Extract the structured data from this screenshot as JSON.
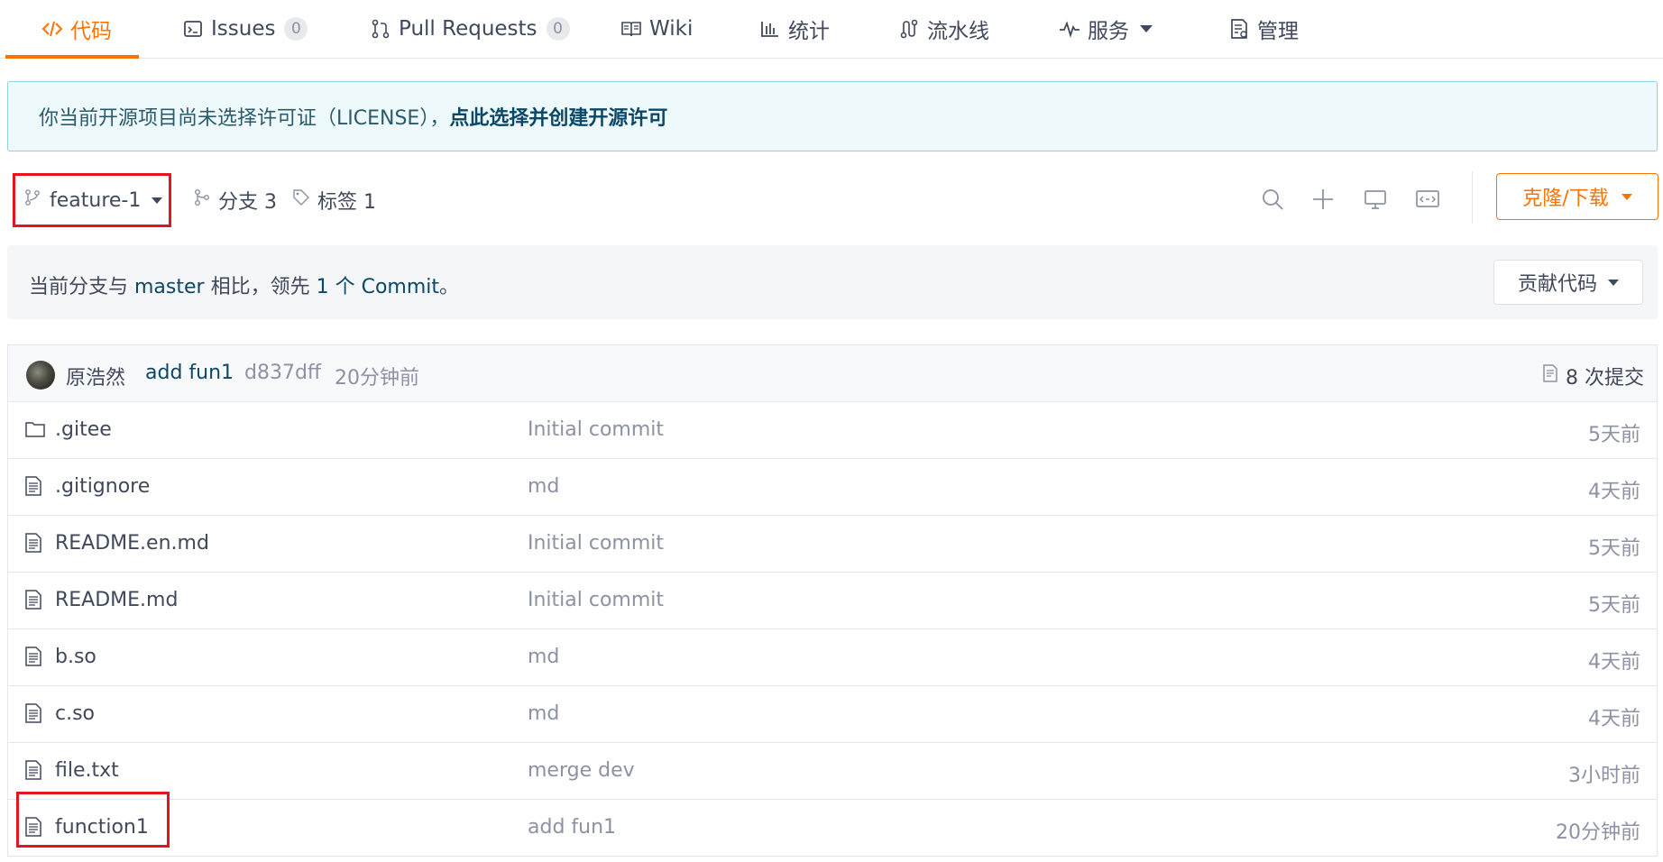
{
  "tabs": [
    {
      "label": "代码",
      "icon": "code-icon",
      "active": true
    },
    {
      "label": "Issues",
      "icon": "issues-icon",
      "badge": "0"
    },
    {
      "label": "Pull Requests",
      "icon": "pull-request-icon",
      "badge": "0"
    },
    {
      "label": "Wiki",
      "icon": "wiki-icon"
    },
    {
      "label": "统计",
      "icon": "stats-icon"
    },
    {
      "label": "流水线",
      "icon": "pipeline-icon"
    },
    {
      "label": "服务",
      "icon": "pulse-icon",
      "dropdown": true
    },
    {
      "label": "管理",
      "icon": "manage-icon"
    }
  ],
  "banner": {
    "text": "你当前开源项目尚未选择许可证（LICENSE），",
    "link": "点此选择并创建开源许可"
  },
  "branch": {
    "current": "feature-1",
    "branches_label": "分支 3",
    "tags_label": "标签 1"
  },
  "toolbar": {
    "clone_label": "克隆/下载",
    "icons": [
      "search-icon",
      "add-icon",
      "monitor-icon",
      "web-ide-icon"
    ]
  },
  "compare": {
    "prefix": "当前分支与 ",
    "base": "master",
    "middle": " 相比，领先 ",
    "ahead": "1 个 Commit",
    "suffix": "。",
    "contribute_label": "贡献代码"
  },
  "last_commit": {
    "author": "原浩然",
    "message": "add fun1",
    "hash": "d837dff",
    "time": "20分钟前",
    "count_label": "8 次提交"
  },
  "files": [
    {
      "name": ".gitee",
      "type": "folder",
      "message": "Initial commit",
      "time": "5天前"
    },
    {
      "name": ".gitignore",
      "type": "file",
      "message": "md",
      "time": "4天前"
    },
    {
      "name": "README.en.md",
      "type": "file",
      "message": "Initial commit",
      "time": "5天前"
    },
    {
      "name": "README.md",
      "type": "file",
      "message": "Initial commit",
      "time": "5天前"
    },
    {
      "name": "b.so",
      "type": "file",
      "message": "md",
      "time": "4天前"
    },
    {
      "name": "c.so",
      "type": "file",
      "message": "md",
      "time": "4天前"
    },
    {
      "name": "file.txt",
      "type": "file",
      "message": "merge dev",
      "time": "3小时前"
    },
    {
      "name": "function1",
      "type": "file",
      "message": "add fun1",
      "time": "20分钟前"
    }
  ],
  "colors": {
    "accent": "#fe7300",
    "link": "#0b4766",
    "highlight": "#e3161f",
    "banner_bg": "#eef9fc"
  }
}
